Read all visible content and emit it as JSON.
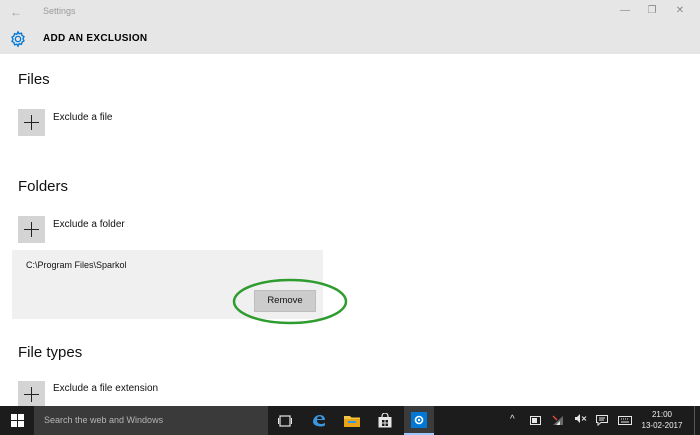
{
  "titlebar": {
    "app_name": "Settings",
    "back_glyph": "←",
    "minimize_glyph": "—",
    "maximize_glyph": "❐",
    "close_glyph": "✕"
  },
  "header": {
    "title": "ADD AN EXCLUSION",
    "icon": "gear-icon"
  },
  "sections": {
    "files": {
      "title": "Files",
      "action": "Exclude a file"
    },
    "folders": {
      "title": "Folders",
      "action": "Exclude a folder",
      "items": [
        {
          "path": "C:\\Program Files\\Sparkol",
          "remove_label": "Remove"
        }
      ]
    },
    "file_types": {
      "title": "File types",
      "action": "Exclude a file extension"
    }
  },
  "taskbar": {
    "search_placeholder": "Search the web and Windows",
    "time": "21:00",
    "date": "13-02-2017",
    "tray": {
      "chevron": "^",
      "network": "✆",
      "volume": "🕪"
    }
  },
  "colors": {
    "accent_blue": "#0078d7",
    "highlight_green": "#2e9c2e",
    "taskbar_bg": "#1c1c1c",
    "header_bg": "#e6e6e6"
  }
}
